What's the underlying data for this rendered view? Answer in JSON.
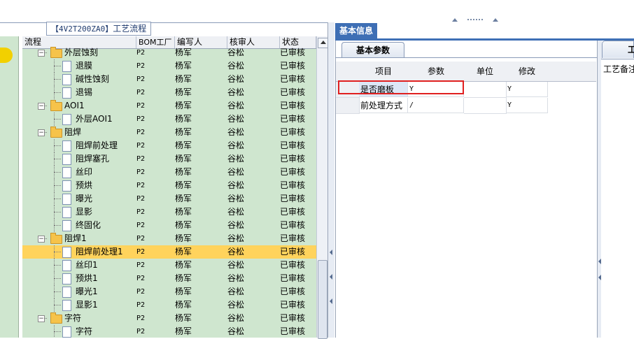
{
  "left_panel": {
    "title_code": "【4V2T200ZA0】",
    "title_text": "工艺流程",
    "columns": [
      "流程",
      "BOM工厂",
      "编写人",
      "核审人",
      "状态"
    ],
    "rows": [
      {
        "name": "外层蚀刻",
        "bom": "P2",
        "writer": "杨军",
        "reviewer": "谷松",
        "status": "已审核",
        "type": "folder",
        "level": 1
      },
      {
        "name": "退膜",
        "bom": "P2",
        "writer": "杨军",
        "reviewer": "谷松",
        "status": "已审核",
        "type": "file",
        "level": 2
      },
      {
        "name": "碱性蚀刻",
        "bom": "P2",
        "writer": "杨军",
        "reviewer": "谷松",
        "status": "已审核",
        "type": "file",
        "level": 2
      },
      {
        "name": "退锡",
        "bom": "P2",
        "writer": "杨军",
        "reviewer": "谷松",
        "status": "已审核",
        "type": "file",
        "level": 2
      },
      {
        "name": "AOI1",
        "bom": "P2",
        "writer": "杨军",
        "reviewer": "谷松",
        "status": "已审核",
        "type": "folder",
        "level": 1
      },
      {
        "name": "外层AOI1",
        "bom": "P2",
        "writer": "杨军",
        "reviewer": "谷松",
        "status": "已审核",
        "type": "file",
        "level": 2
      },
      {
        "name": "阻焊",
        "bom": "P2",
        "writer": "杨军",
        "reviewer": "谷松",
        "status": "已审核",
        "type": "folder",
        "level": 1
      },
      {
        "name": "阻焊前处理",
        "bom": "P2",
        "writer": "杨军",
        "reviewer": "谷松",
        "status": "已审核",
        "type": "file",
        "level": 2
      },
      {
        "name": "阻焊塞孔",
        "bom": "P2",
        "writer": "杨军",
        "reviewer": "谷松",
        "status": "已审核",
        "type": "file",
        "level": 2
      },
      {
        "name": "丝印",
        "bom": "P2",
        "writer": "杨军",
        "reviewer": "谷松",
        "status": "已审核",
        "type": "file",
        "level": 2
      },
      {
        "name": "预烘",
        "bom": "P2",
        "writer": "杨军",
        "reviewer": "谷松",
        "status": "已审核",
        "type": "file",
        "level": 2
      },
      {
        "name": "曝光",
        "bom": "P2",
        "writer": "杨军",
        "reviewer": "谷松",
        "status": "已审核",
        "type": "file",
        "level": 2
      },
      {
        "name": "显影",
        "bom": "P2",
        "writer": "杨军",
        "reviewer": "谷松",
        "status": "已审核",
        "type": "file",
        "level": 2
      },
      {
        "name": "终固化",
        "bom": "P2",
        "writer": "杨军",
        "reviewer": "谷松",
        "status": "已审核",
        "type": "file",
        "level": 2
      },
      {
        "name": "阻焊1",
        "bom": "P2",
        "writer": "杨军",
        "reviewer": "谷松",
        "status": "已审核",
        "type": "folder",
        "level": 1
      },
      {
        "name": "阻焊前处理1",
        "bom": "P2",
        "writer": "杨军",
        "reviewer": "谷松",
        "status": "已审核",
        "type": "file",
        "level": 2,
        "selected": true
      },
      {
        "name": "丝印1",
        "bom": "P2",
        "writer": "杨军",
        "reviewer": "谷松",
        "status": "已审核",
        "type": "file",
        "level": 2
      },
      {
        "name": "预烘1",
        "bom": "P2",
        "writer": "杨军",
        "reviewer": "谷松",
        "status": "已审核",
        "type": "file",
        "level": 2
      },
      {
        "name": "曝光1",
        "bom": "P2",
        "writer": "杨军",
        "reviewer": "谷松",
        "status": "已审核",
        "type": "file",
        "level": 2
      },
      {
        "name": "显影1",
        "bom": "P2",
        "writer": "杨军",
        "reviewer": "谷松",
        "status": "已审核",
        "type": "file",
        "level": 2
      },
      {
        "name": "字符",
        "bom": "P2",
        "writer": "杨军",
        "reviewer": "谷松",
        "status": "已审核",
        "type": "folder",
        "level": 1
      },
      {
        "name": "字符",
        "bom": "P2",
        "writer": "杨军",
        "reviewer": "谷松",
        "status": "已审核",
        "type": "file",
        "level": 2
      }
    ]
  },
  "right_panel": {
    "tab_label": "基本信息",
    "subtab_label": "基本参数",
    "grid_columns": [
      "项目",
      "参数",
      "单位",
      "修改"
    ],
    "grid_rows": [
      {
        "item": "是否磨板",
        "param": "Y",
        "unit": "",
        "modify": "Y"
      },
      {
        "item": "前处理方式",
        "param": "/",
        "unit": "",
        "modify": "Y"
      }
    ],
    "side_tab_label": "工",
    "side_note": "工艺备注"
  },
  "colors": {
    "tree_bg": "#cfe6cf",
    "selected_row": "#ffd35c",
    "tab_blue": "#3e6fb5",
    "highlight_box": "#e02020"
  }
}
